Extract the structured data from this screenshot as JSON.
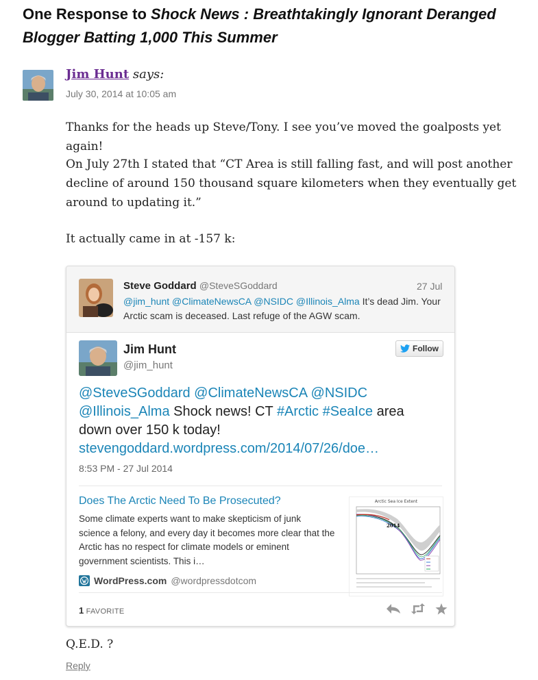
{
  "heading": {
    "prefix": "One Response to ",
    "title": "Shock News : Breathtakingly Ignorant Deranged Blogger Batting 1,000 This Summer"
  },
  "comment": {
    "author": "Jim Hunt",
    "says": " says:",
    "date": "July 30, 2014 at 10:05 am",
    "paragraphs": [
      "Thanks for the heads up Steve/Tony. I see you’ve moved the goalposts yet again!",
      "On July 27th I stated that “CT Area is still falling fast, and will post another decline of around 150 thousand square kilometers when they eventually get around to updating it.”",
      "It actually came in at -157 k:"
    ],
    "closing": "Q.E.D. ?",
    "reply": "Reply"
  },
  "tweet": {
    "parent": {
      "name": "Steve Goddard",
      "handle": "@SteveSGoddard",
      "date": "27 Jul",
      "mentions": "@jim_hunt @ClimateNewsCA @NSIDC @Illinois_Alma",
      "text_line1": " It’s dead Jim. Your",
      "text_line2": "Arctic scam is deceased. Last refuge of the AGW scam."
    },
    "main": {
      "name": "Jim Hunt",
      "handle": "@jim_hunt",
      "follow_label": "Follow",
      "line1": "@SteveSGoddard @ClimateNewsCA @NSIDC",
      "l2_mention": "@Illinois_Alma",
      "l2_text": " Shock news! CT ",
      "l2_tag1": "#Arctic",
      "l2_space": " ",
      "l2_tag2": "#SeaIce",
      "l2_end": " area",
      "line3": "down over 150 k today!",
      "link": "stevengoddard.wordpress.com/2014/07/26/doe…",
      "timestamp": "8:53 PM - 27 Jul 2014"
    },
    "card": {
      "title": "Does The Arctic Need To Be Prosecuted?",
      "desc": [
        "Some climate experts want to make skepticism of junk",
        "science a felony, and every day it becomes more clear that the",
        "Arctic has no respect for climate models or eminent",
        "government scientists. This i…"
      ],
      "site_name": "WordPress.com",
      "site_handle": "@wordpressdotcom",
      "thumb_title": "Arctic Sea Ice Extent",
      "thumb_label": "2014"
    },
    "footer": {
      "favorite_count": "1",
      "favorite_label": "FAVORITE"
    }
  },
  "colors": {
    "link": "#1b85b7",
    "author": "#6a2c91",
    "twitter_bird": "#1da1f2"
  }
}
